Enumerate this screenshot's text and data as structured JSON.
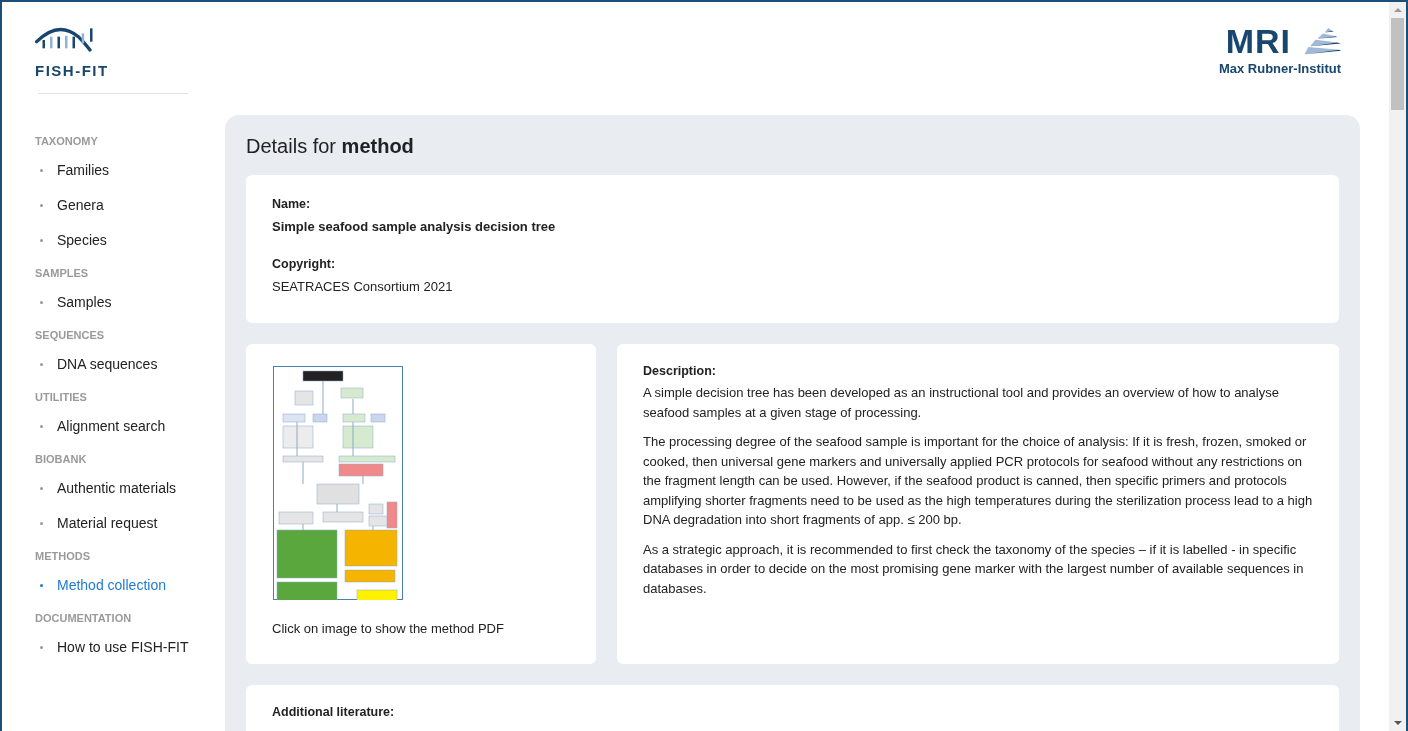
{
  "header": {
    "logo": {
      "text": "FISH-FIT"
    },
    "partner_logo": {
      "abbreviation": "MRI",
      "name": "Max Rubner-Institut"
    }
  },
  "sidebar": {
    "sections": [
      {
        "heading": "TAXONOMY",
        "items": [
          {
            "label": "Families",
            "selected": false
          },
          {
            "label": "Genera",
            "selected": false
          },
          {
            "label": "Species",
            "selected": false
          }
        ]
      },
      {
        "heading": "SAMPLES",
        "items": [
          {
            "label": "Samples",
            "selected": false
          }
        ]
      },
      {
        "heading": "SEQUENCES",
        "items": [
          {
            "label": "DNA sequences",
            "selected": false
          }
        ]
      },
      {
        "heading": "UTILITIES",
        "items": [
          {
            "label": "Alignment search",
            "selected": false
          }
        ]
      },
      {
        "heading": "BIOBANK",
        "items": [
          {
            "label": "Authentic materials",
            "selected": false
          },
          {
            "label": "Material request",
            "selected": false
          }
        ]
      },
      {
        "heading": "METHODS",
        "items": [
          {
            "label": "Method collection",
            "selected": true
          }
        ]
      },
      {
        "heading": "DOCUMENTATION",
        "items": [
          {
            "label": "How to use FISH-FIT",
            "selected": false
          }
        ]
      }
    ]
  },
  "page": {
    "title": "Details for **method**"
  },
  "details": {
    "name": {
      "label": "Name:",
      "value": "Simple seafood sample analysis decision tree"
    },
    "copyright": {
      "label": "Copyright:",
      "value": "SEATRACES Consortium 2021"
    }
  },
  "method_image": {
    "caption": "Click on image to show the method PDF"
  },
  "description": {
    "label": "Description:",
    "paragraphs": [
      "A simple decision tree has been developed as an instructional tool and provides an overview of how to analyse seafood samples at a given stage of processing.",
      "The processing degree of the seafood sample is important for the choice of analysis: If it is fresh, frozen, smoked or cooked, then universal gene markers and universally applied PCR protocols for seafood without any restrictions on the fragment length can be used. However, if the seafood product is canned, then specific primers and protocols amplifying shorter fragments need to be used as the high temperatures during the sterilization process lead to a high DNA degradation into short fragments of app. ≤ 200 bp.",
      "As a strategic approach, it is recommended to first check the taxonomy of the species – if it is labelled - in specific databases in order to decide on the most promising gene marker with the largest number of available sequences in databases."
    ]
  },
  "additional_literature": {
    "label": "Additional literature:"
  }
}
